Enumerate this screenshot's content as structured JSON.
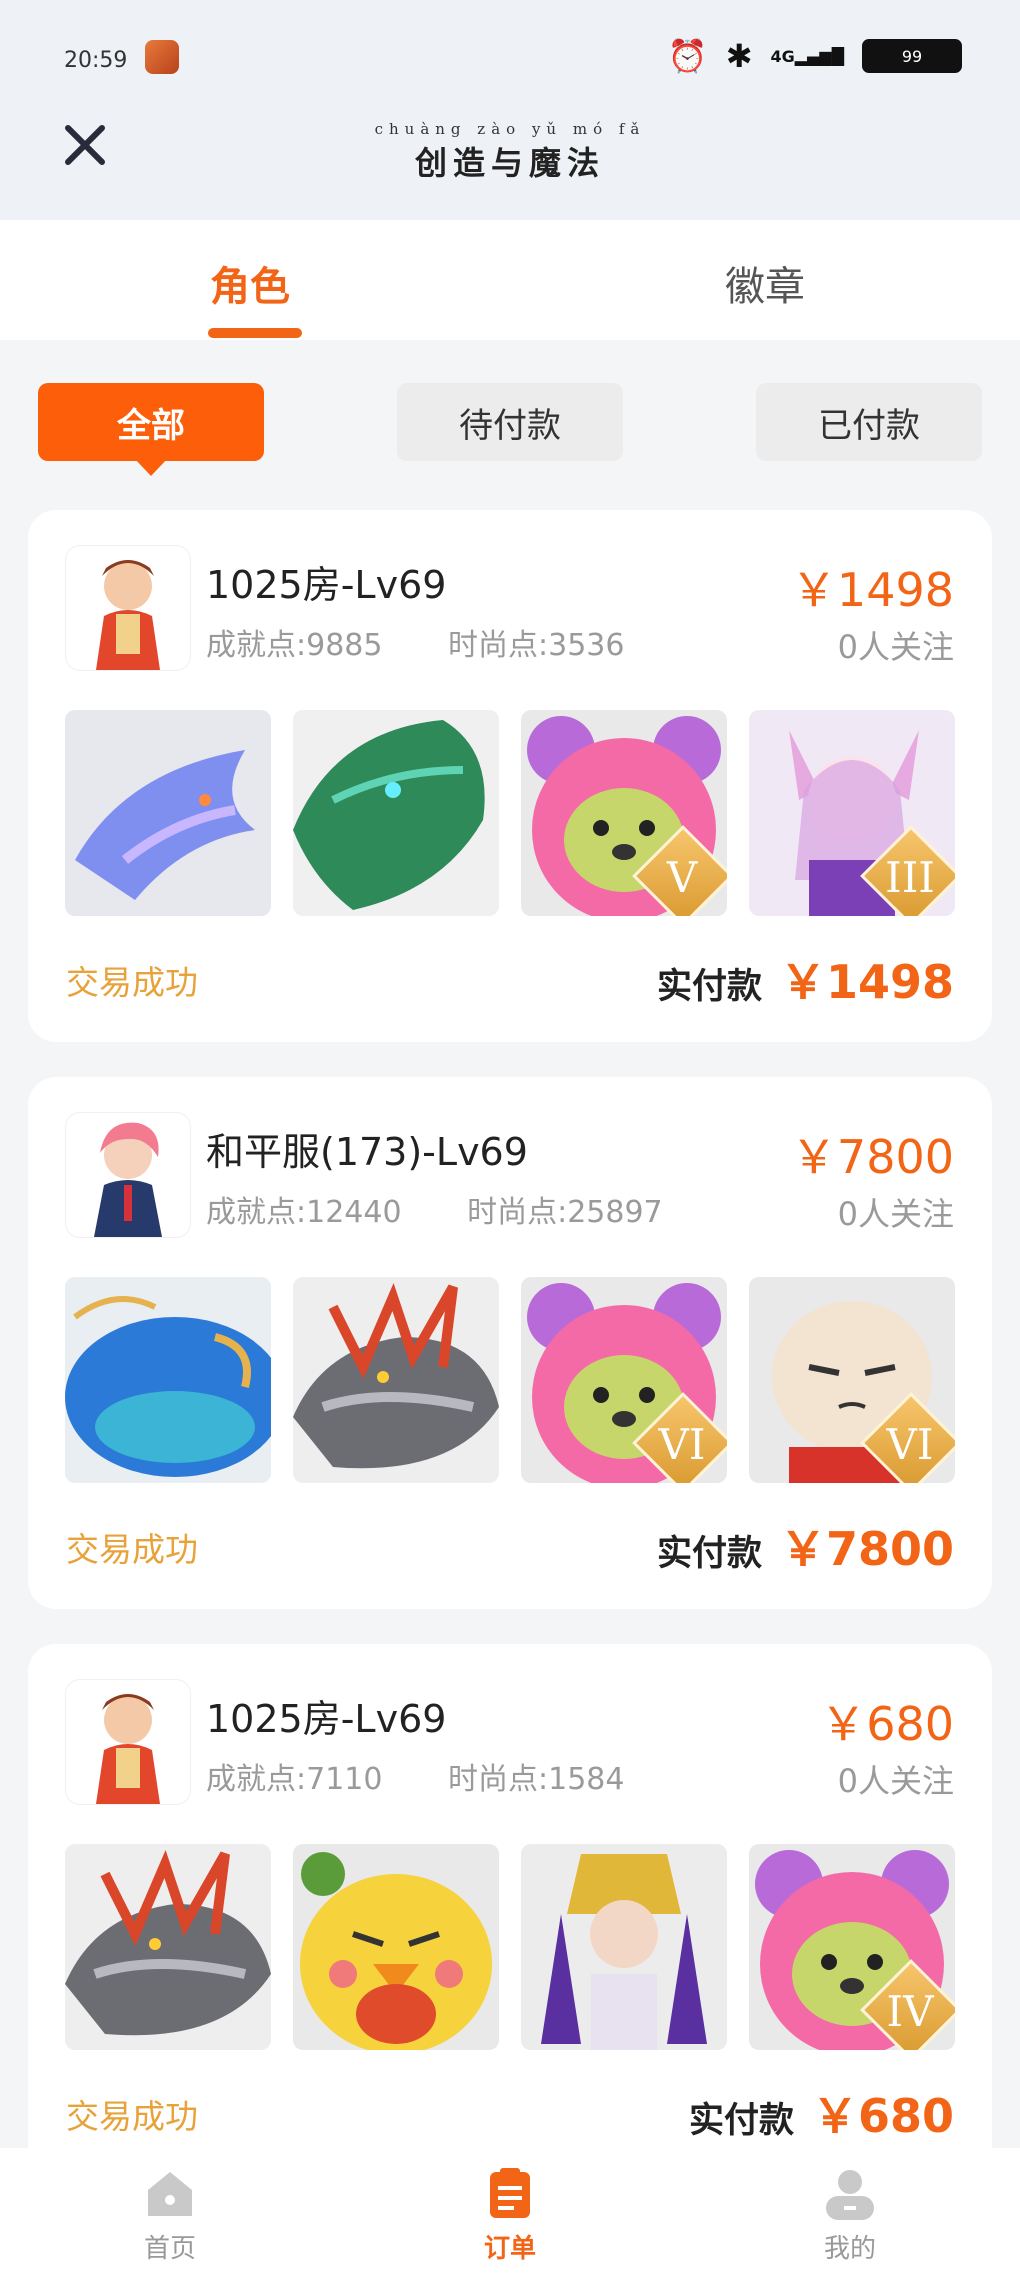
{
  "status_bar": {
    "time": "20:59",
    "signal": "4G",
    "battery": "99"
  },
  "header": {
    "title_pinyin": "chuàng zào yǔ mó fǎ",
    "title": "创造与魔法",
    "close_icon": "close-icon"
  },
  "tabs": [
    {
      "label": "角色",
      "active": true
    },
    {
      "label": "徽章",
      "active": false
    }
  ],
  "filters": [
    {
      "label": "全部",
      "active": true
    },
    {
      "label": "待付款",
      "active": false
    },
    {
      "label": "已付款",
      "active": false
    }
  ],
  "orders": [
    {
      "server": "1025房-Lv69",
      "achievement": "成就点:9885",
      "fashion": "时尚点:3536",
      "price": "￥1498",
      "watchers": "0人关注",
      "status": "交易成功",
      "paid_label": "实付款",
      "paid_value": "￥1498",
      "items": [
        {
          "kind": "dragon-blue"
        },
        {
          "kind": "dragon-green"
        },
        {
          "kind": "bear-pink",
          "rank": "V"
        },
        {
          "kind": "fox-girl",
          "rank": "III"
        }
      ]
    },
    {
      "server": "和平服(173)-Lv69",
      "achievement": "成就点:12440",
      "fashion": "时尚点:25897",
      "price": "￥7800",
      "watchers": "0人关注",
      "status": "交易成功",
      "paid_label": "实付款",
      "paid_value": "￥7800",
      "items": [
        {
          "kind": "whale-blue"
        },
        {
          "kind": "dragon-grey"
        },
        {
          "kind": "bear-pink",
          "rank": "VI"
        },
        {
          "kind": "bun-face",
          "rank": "VI"
        }
      ]
    },
    {
      "server": "1025房-Lv69",
      "achievement": "成就点:7110",
      "fashion": "时尚点:1584",
      "price": "￥680",
      "watchers": "0人关注",
      "status": "交易成功",
      "paid_label": "实付款",
      "paid_value": "￥680",
      "items": [
        {
          "kind": "dragon-grey"
        },
        {
          "kind": "chick-yellow"
        },
        {
          "kind": "pharaoh-girl"
        },
        {
          "kind": "bear-pink",
          "rank": "IV"
        }
      ]
    }
  ],
  "bottom_nav": [
    {
      "label": "首页",
      "icon": "home-icon",
      "active": false
    },
    {
      "label": "订单",
      "icon": "orders-icon",
      "active": true
    },
    {
      "label": "我的",
      "icon": "profile-icon",
      "active": false
    }
  ],
  "colors": {
    "accent": "#f26516",
    "status": "#e8a23a",
    "filter_active": "#fc5e0a"
  }
}
